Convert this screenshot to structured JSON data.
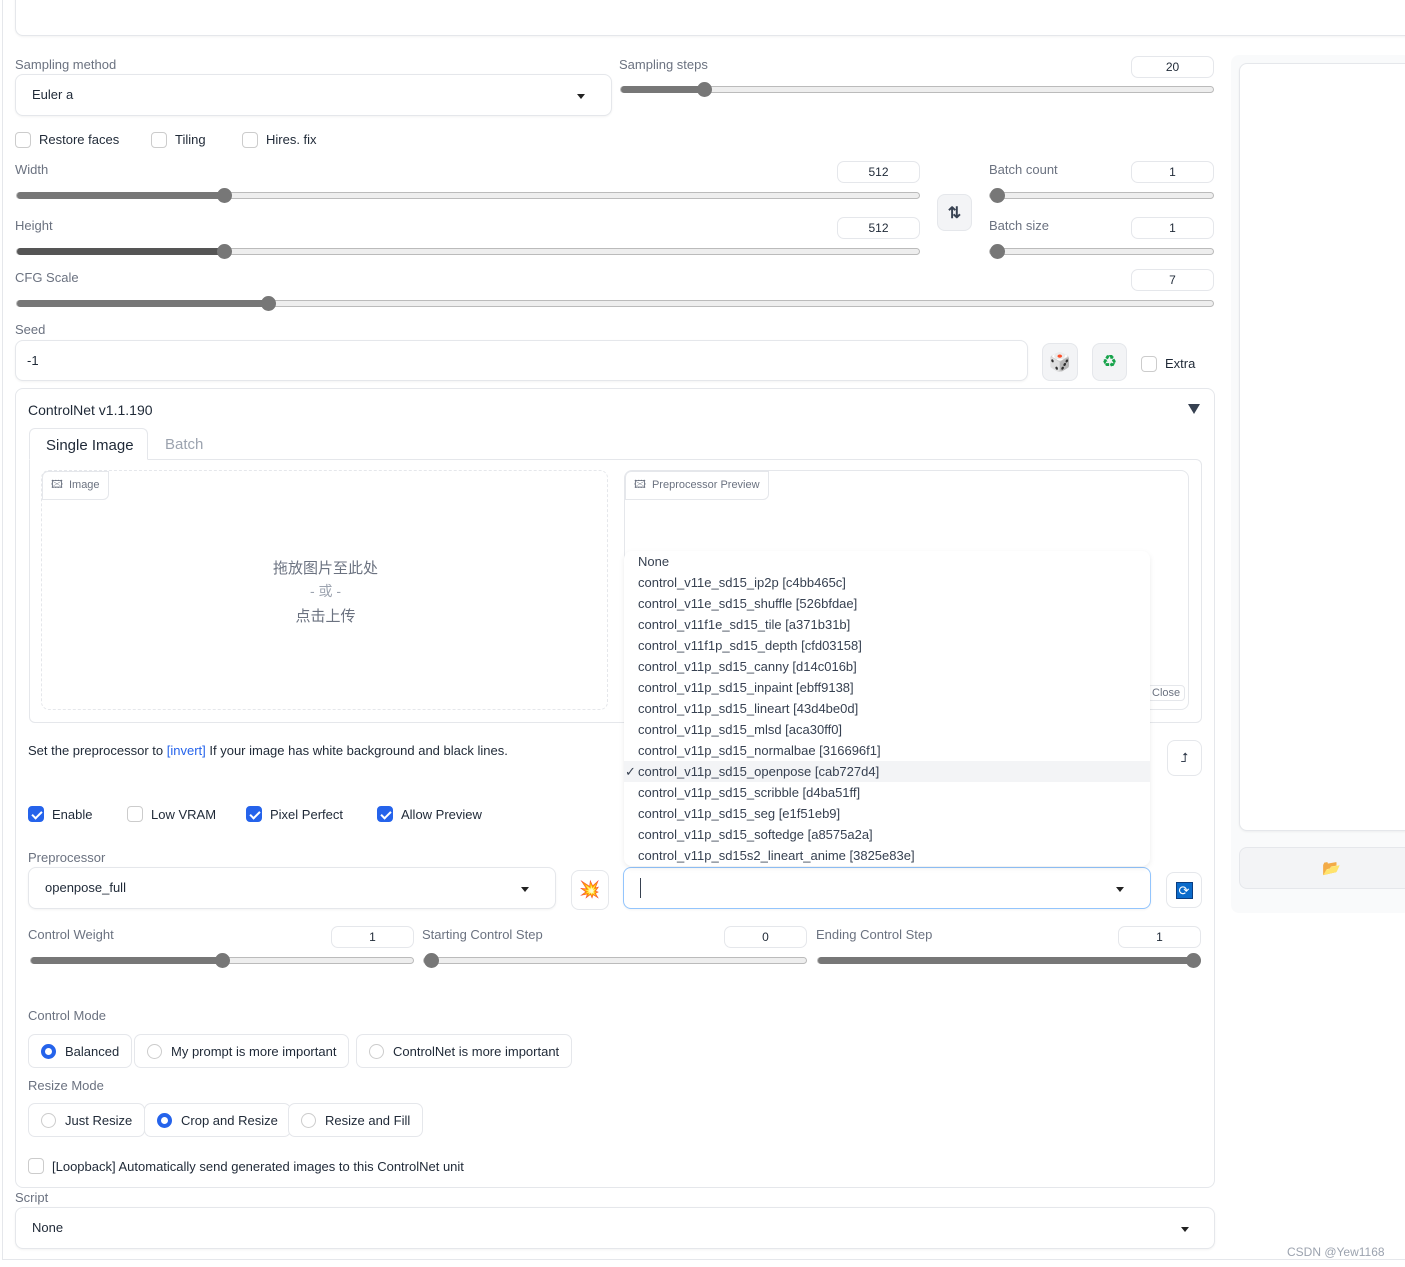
{
  "sampling": {
    "method_label": "Sampling method",
    "method_value": "Euler a",
    "steps_label": "Sampling steps",
    "steps_value": "20",
    "steps_fraction": 0.14
  },
  "options": {
    "restore_faces": "Restore faces",
    "tiling": "Tiling",
    "hires_fix": "Hires. fix"
  },
  "size": {
    "width_label": "Width",
    "width_value": "512",
    "height_label": "Height",
    "height_value": "512",
    "swap_icon": "swap-vertical-icon"
  },
  "batch": {
    "count_label": "Batch count",
    "count_value": "1",
    "size_label": "Batch size",
    "size_value": "1"
  },
  "cfg": {
    "label": "CFG Scale",
    "value": "7"
  },
  "seed": {
    "label": "Seed",
    "value": "-1",
    "extra_label": "Extra",
    "dice_icon": "dice-icon",
    "recycle_icon": "recycle-icon"
  },
  "controlnet": {
    "title": "ControlNet v1.1.190",
    "tabs": [
      "Single Image",
      "Batch"
    ],
    "image_label": "Image",
    "drop_text": "拖放图片至此处",
    "or_text": "- 或 -",
    "click_text": "点击上传",
    "preview_label": "Preprocessor Preview",
    "close_label": "Close",
    "hint_prefix": "Set the preprocessor to ",
    "hint_link": "[invert]",
    "hint_suffix": " If your image has white background and black lines.",
    "enable": "Enable",
    "low_vram": "Low VRAM",
    "pixel_perfect": "Pixel Perfect",
    "allow_preview": "Allow Preview",
    "preprocessor_label": "Preprocessor",
    "preprocessor_value": "openpose_full",
    "model_value": "",
    "model_options": [
      "None",
      "control_v11e_sd15_ip2p [c4bb465c]",
      "control_v11e_sd15_shuffle [526bfdae]",
      "control_v11f1e_sd15_tile [a371b31b]",
      "control_v11f1p_sd15_depth [cfd03158]",
      "control_v11p_sd15_canny [d14c016b]",
      "control_v11p_sd15_inpaint [ebff9138]",
      "control_v11p_sd15_lineart [43d4be0d]",
      "control_v11p_sd15_mlsd [aca30ff0]",
      "control_v11p_sd15_normalbae [316696f1]",
      "control_v11p_sd15_openpose [cab727d4]",
      "control_v11p_sd15_scribble [d4ba51ff]",
      "control_v11p_sd15_seg [e1f51eb9]",
      "control_v11p_sd15_softedge [a8575a2a]",
      "control_v11p_sd15s2_lineart_anime [3825e83e]"
    ],
    "selected_model": "control_v11p_sd15_openpose [cab727d4]",
    "check_mark": "✓",
    "weight_label": "Control Weight",
    "weight_value": "1",
    "weight_fraction": 0.5,
    "start_label": "Starting Control Step",
    "start_value": "0",
    "start_fraction": 0,
    "end_label": "Ending Control Step",
    "end_value": "1",
    "end_fraction": 1,
    "control_mode_label": "Control Mode",
    "control_modes": [
      "Balanced",
      "My prompt is more important",
      "ControlNet is more important"
    ],
    "resize_mode_label": "Resize Mode",
    "resize_modes": [
      "Just Resize",
      "Crop and Resize",
      "Resize and Fill"
    ],
    "loopback": "[Loopback] Automatically send generated images to this ControlNet unit"
  },
  "script": {
    "label": "Script",
    "value": "None"
  },
  "watermark": "CSDN @Yew1168",
  "colors": {
    "accent": "#2563eb",
    "link": "#2563eb"
  }
}
